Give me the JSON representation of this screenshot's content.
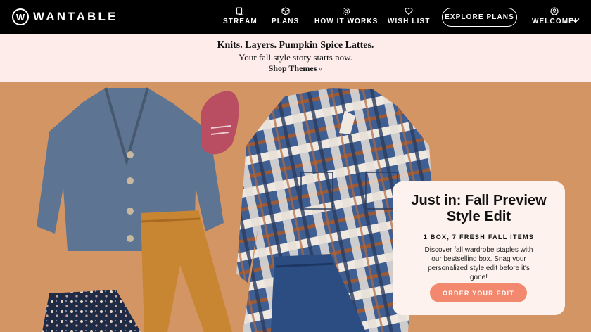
{
  "brand": {
    "logo_mark": "W",
    "name": "WANTABLE"
  },
  "nav": {
    "items": [
      {
        "label": "STREAM",
        "icon": "stream-icon"
      },
      {
        "label": "PLANS",
        "icon": "box-icon"
      },
      {
        "label": "HOW IT WORKS",
        "icon": "gear-icon"
      },
      {
        "label": "WISH LIST",
        "icon": "heart-icon"
      }
    ],
    "explore_label": "EXPLORE PLANS",
    "account_label": "WELCOME!"
  },
  "promo": {
    "headline": "Knits. Layers. Pumpkin Spice Lattes.",
    "subline": "Your fall style story starts now.",
    "link_label": "Shop Themes",
    "link_suffix": "»"
  },
  "hero": {
    "card": {
      "title_line1": "Just in: Fall Preview",
      "title_line2": "Style Edit",
      "subtitle": "1 BOX, 7 FRESH FALL ITEMS",
      "body": "Discover fall wardrobe staples with our bestselling box. Snag your personalized style edit before it's gone!",
      "button_label": "ORDER YOUR EDIT"
    }
  },
  "colors": {
    "nav_bg": "#000000",
    "promo_bg": "#fdecea",
    "hero_bg": "#d39563",
    "card_bg": "#fdf2ed",
    "cta": "#f2896f"
  }
}
